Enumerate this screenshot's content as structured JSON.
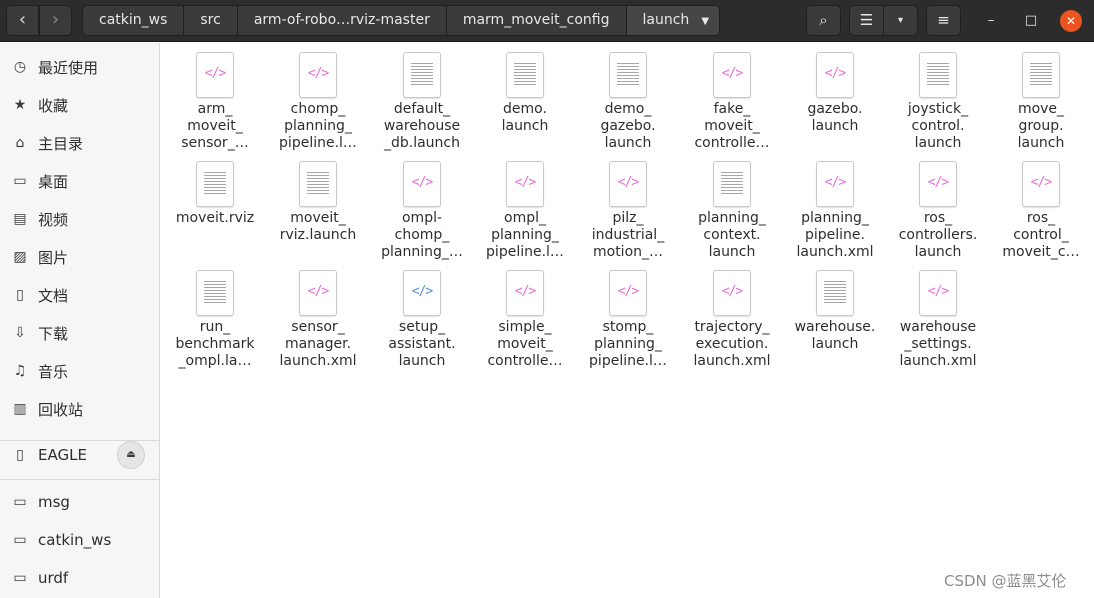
{
  "header": {
    "back_icon": "‹",
    "forward_icon": "›",
    "breadcrumbs": [
      "catkin_ws",
      "src",
      "arm-of-robo…rviz-master",
      "marm_moveit_config",
      "launch"
    ],
    "search_icon": "⌕",
    "view_icon": "☰",
    "view_dropdown_icon": "▾",
    "menu_icon": "≡",
    "minimize_icon": "–",
    "maximize_icon": "□",
    "close_icon": "✕"
  },
  "sidebar": {
    "places": [
      {
        "label": "最近使用",
        "icon": "recent-icon",
        "glyph": "◷"
      },
      {
        "label": "收藏",
        "icon": "star-icon",
        "glyph": "★"
      },
      {
        "label": "主目录",
        "icon": "home-icon",
        "glyph": "⌂"
      },
      {
        "label": "桌面",
        "icon": "desktop-icon",
        "glyph": "▭"
      },
      {
        "label": "视频",
        "icon": "video-icon",
        "glyph": "▤"
      },
      {
        "label": "图片",
        "icon": "picture-icon",
        "glyph": "▨"
      },
      {
        "label": "文档",
        "icon": "document-icon",
        "glyph": "▯"
      },
      {
        "label": "下载",
        "icon": "download-icon",
        "glyph": "⇩"
      },
      {
        "label": "音乐",
        "icon": "music-icon",
        "glyph": "♫"
      },
      {
        "label": "回收站",
        "icon": "trash-icon",
        "glyph": "▥"
      }
    ],
    "device": {
      "label": "EAGLE",
      "icon": "usb-icon",
      "glyph": "▯",
      "eject_icon": "⏏"
    },
    "bookmarks": [
      {
        "label": "msg",
        "icon": "folder-icon",
        "glyph": "▭"
      },
      {
        "label": "catkin_ws",
        "icon": "folder-icon",
        "glyph": "▭"
      },
      {
        "label": "urdf",
        "icon": "folder-icon",
        "glyph": "▭"
      }
    ]
  },
  "files": [
    {
      "name": "arm_\nmoveit_\nsensor_…",
      "type": "xml"
    },
    {
      "name": "chomp_\nplanning_\npipeline.l…",
      "type": "xml"
    },
    {
      "name": "default_\nwarehouse\n_db.launch",
      "type": "text"
    },
    {
      "name": "demo.\nlaunch",
      "type": "text"
    },
    {
      "name": "demo_\ngazebo.\nlaunch",
      "type": "text"
    },
    {
      "name": "fake_\nmoveit_\ncontrolle…",
      "type": "xml"
    },
    {
      "name": "gazebo.\nlaunch",
      "type": "xml"
    },
    {
      "name": "joystick_\ncontrol.\nlaunch",
      "type": "text"
    },
    {
      "name": "move_\ngroup.\nlaunch",
      "type": "text"
    },
    {
      "name": "moveit.rviz",
      "type": "text"
    },
    {
      "name": "moveit_\nrviz.launch",
      "type": "text"
    },
    {
      "name": "ompl-\nchomp_\nplanning_…",
      "type": "xml"
    },
    {
      "name": "ompl_\nplanning_\npipeline.l…",
      "type": "xml"
    },
    {
      "name": "pilz_\nindustrial_\nmotion_…",
      "type": "xml"
    },
    {
      "name": "planning_\ncontext.\nlaunch",
      "type": "text"
    },
    {
      "name": "planning_\npipeline.\nlaunch.xml",
      "type": "xml"
    },
    {
      "name": "ros_\ncontrollers.\nlaunch",
      "type": "xml"
    },
    {
      "name": "ros_\ncontrol_\nmoveit_c…",
      "type": "xml"
    },
    {
      "name": "run_\nbenchmark\n_ompl.la…",
      "type": "text"
    },
    {
      "name": "sensor_\nmanager.\nlaunch.xml",
      "type": "xml"
    },
    {
      "name": "setup_\nassistant.\nlaunch",
      "type": "xml-blue"
    },
    {
      "name": "simple_\nmoveit_\ncontrolle…",
      "type": "xml"
    },
    {
      "name": "stomp_\nplanning_\npipeline.l…",
      "type": "xml"
    },
    {
      "name": "trajectory_\nexecution.\nlaunch.xml",
      "type": "xml"
    },
    {
      "name": "warehouse.\nlaunch",
      "type": "text"
    },
    {
      "name": "warehouse\n_settings.\nlaunch.xml",
      "type": "xml"
    }
  ],
  "xml_glyph": "</>",
  "watermark": "CSDN @蓝黑艾伦"
}
